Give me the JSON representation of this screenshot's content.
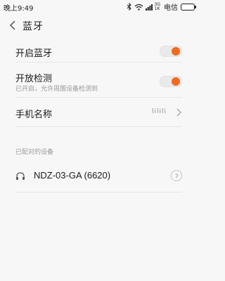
{
  "status_bar": {
    "time": "晚上9:49",
    "network_top": "3G",
    "network_bottom": "1K",
    "carrier": "电信",
    "icons": [
      "bluetooth-icon",
      "wifi-icon",
      "signal-icon",
      "battery-icon"
    ]
  },
  "header": {
    "title": "蓝牙",
    "back_icon": "chevron-left-icon"
  },
  "settings": {
    "bluetooth_toggle": {
      "label": "开启蓝牙",
      "on": true
    },
    "discoverable_toggle": {
      "label": "开放检测",
      "subtitle": "已开启，允许周围设备检测到",
      "on": true
    },
    "device_name": {
      "label": "手机名称",
      "value": "lilili"
    }
  },
  "paired_section": {
    "header": "已配对的设备",
    "devices": [
      {
        "name": "NDZ-03-GA (6620)",
        "icon": "headset-icon",
        "action_icon": "info-icon"
      }
    ]
  },
  "colors": {
    "accent": "#f06a1e",
    "background": "#f7f7f7",
    "divider": "#e6e6e6"
  }
}
